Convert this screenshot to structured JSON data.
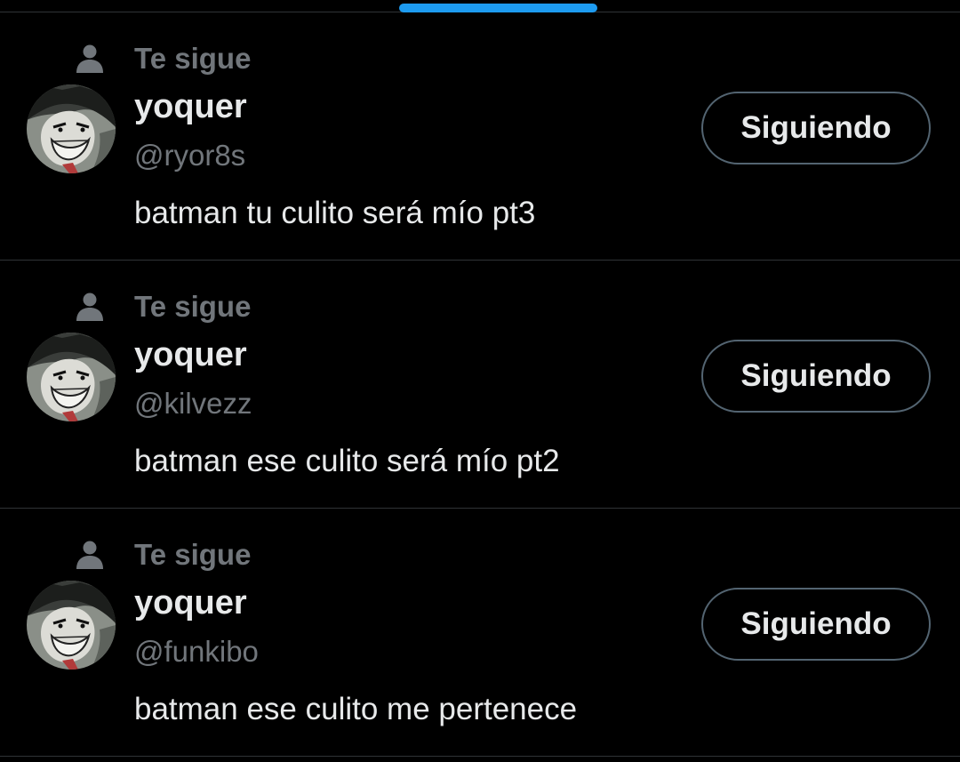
{
  "colors": {
    "background": "#000000",
    "primary_text": "#e7e9ea",
    "secondary_text": "#71767b",
    "divider": "#2f3336",
    "accent": "#1d9bf0",
    "button_border": "#536471"
  },
  "tab_indicator": {
    "color": "#1d9bf0"
  },
  "users": [
    {
      "follows_you_icon": "person-icon",
      "follows_you_label": "Te sigue",
      "avatar_icon": "joker-avatar",
      "display_name": "yoquer",
      "handle": "@ryor8s",
      "bio": "batman tu culito será mío pt3",
      "button_label": "Siguiendo"
    },
    {
      "follows_you_icon": "person-icon",
      "follows_you_label": "Te sigue",
      "avatar_icon": "joker-avatar",
      "display_name": "yoquer",
      "handle": "@kilvezz",
      "bio": "batman ese culito será mío pt2",
      "button_label": "Siguiendo"
    },
    {
      "follows_you_icon": "person-icon",
      "follows_you_label": "Te sigue",
      "avatar_icon": "joker-avatar",
      "display_name": "yoquer",
      "handle": "@funkibo",
      "bio": "batman ese culito me pertenece",
      "button_label": "Siguiendo"
    }
  ]
}
